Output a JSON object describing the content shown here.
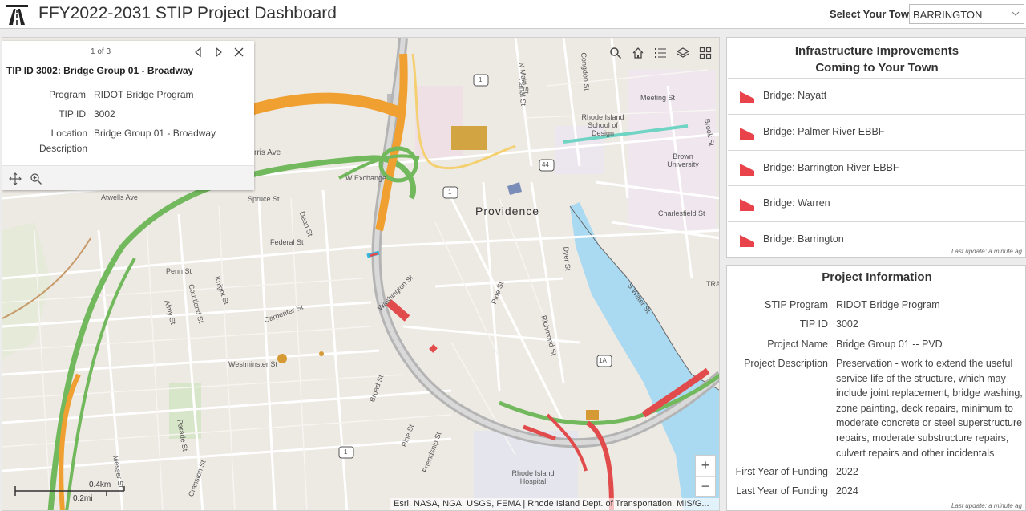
{
  "header": {
    "title": "FFY2022-2031 STIP Project Dashboard",
    "town_label": "Select Your Town:",
    "town_value": "BARRINGTON"
  },
  "map": {
    "labels": {
      "providence": "Providence",
      "n_main": "N Main St",
      "canal": "Canal St",
      "congdon": "Congdon St",
      "meeting": "Meeting St",
      "risd": "Rhode Island School of Design",
      "brook": "Brook St",
      "brown": "Brown University",
      "charlesfield": "Charlesfield St",
      "atwells": "Atwells Ave",
      "spruce": "Spruce St",
      "w_exchange": "W Exchange",
      "dean": "Dean St",
      "federal": "Federal St",
      "dyer": "Dyer St",
      "penn": "Penn St",
      "knight": "Knight St",
      "courtland": "Courtland St",
      "almy": "Almy St",
      "carpenter": "Carpenter St",
      "washington": "Washington St",
      "pine": "Pine St",
      "richmond": "Richmond St",
      "s_water": "S Water St",
      "westminster": "Westminster St",
      "broad": "Broad St",
      "pine2": "Pine St",
      "friendship": "Friendship St",
      "parade": "Parade St",
      "messer": "Messer St",
      "cranston": "Cranston St",
      "ri_hospital": "Rhode Island Hospital",
      "harris": "rris Ave",
      "trad": "TRAD",
      "route_1": "1",
      "route_44": "44",
      "route_1a": "1A"
    },
    "scale_km": "0.4km",
    "scale_mi": "0.2mi",
    "attribution": "Esri, NASA, NGA, USGS, FEMA | Rhode Island Dept. of Transportation, MIS/G...",
    "zoom_in": "+",
    "zoom_out": "−"
  },
  "popup": {
    "count": "1 of 3",
    "title": "TIP ID 3002: Bridge Group 01 - Broadway",
    "fields": [
      {
        "key": "Program",
        "value": "RIDOT Bridge Program"
      },
      {
        "key": "TIP ID",
        "value": "3002"
      },
      {
        "key": "Location Description",
        "value": "Bridge Group 01 - Broadway"
      }
    ]
  },
  "infra": {
    "title_line1": "Infrastructure Improvements",
    "title_line2": "Coming to Your Town",
    "items": [
      {
        "label": "Bridge: Nayatt"
      },
      {
        "label": "Bridge: Palmer River EBBF"
      },
      {
        "label": "Bridge: Barrington River EBBF"
      },
      {
        "label": "Bridge: Warren"
      },
      {
        "label": "Bridge: Barrington"
      }
    ],
    "last_update": "Last update: a minute ag"
  },
  "project": {
    "title": "Project Information",
    "fields": [
      {
        "key": "STIP Program",
        "value": "RIDOT Bridge Program"
      },
      {
        "key": "TIP ID",
        "value": "3002"
      },
      {
        "key": "Project Name",
        "value": "Bridge Group 01 -- PVD"
      },
      {
        "key": "Project Description",
        "value": "Preservation - work to extend the useful service life of the structure, which may include joint replacement, bridge washing, zone painting, deck repairs, minimum to moderate concrete or steel superstructure repairs, moderate substructure repairs, culvert repairs and other incidentals"
      },
      {
        "key": "First Year of Funding",
        "value": "2022"
      },
      {
        "key": "Last Year of Funding",
        "value": "2024"
      }
    ],
    "last_update": "Last update: a minute ag"
  },
  "colors": {
    "flag": "#e8424a",
    "highway_green": "#72b85c",
    "highway_orange": "#f0a030",
    "highway_red": "#e14b4b",
    "water": "#aadaf2"
  }
}
